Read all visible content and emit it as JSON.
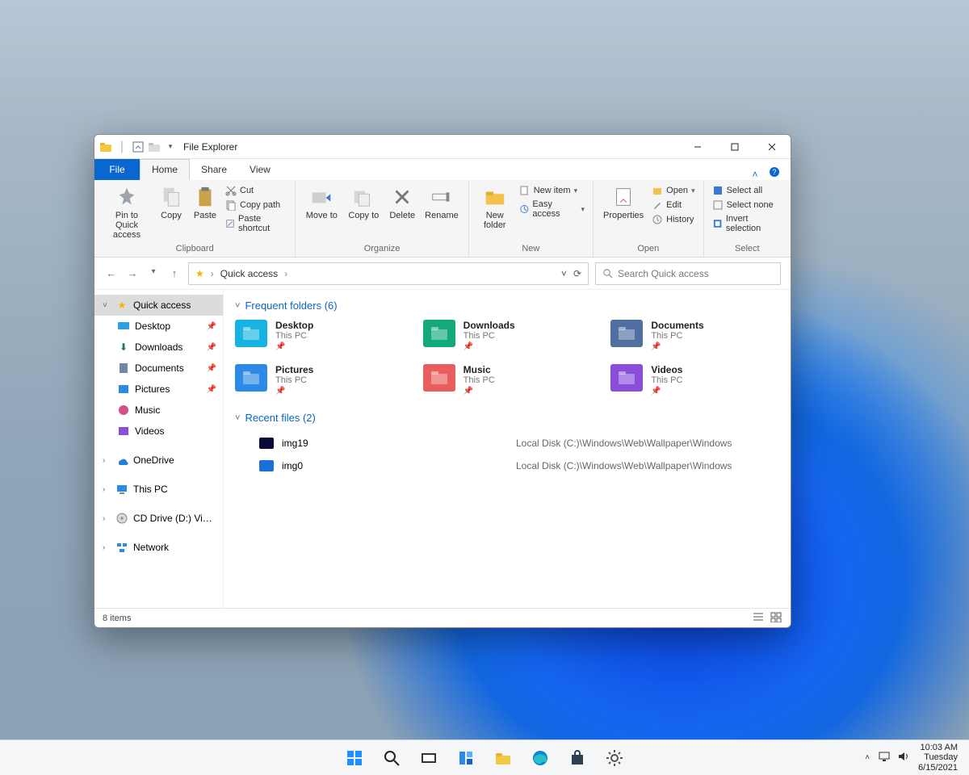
{
  "window": {
    "title": "File Explorer"
  },
  "tabs": {
    "file": "File",
    "home": "Home",
    "share": "Share",
    "view": "View"
  },
  "ribbon": {
    "clipboard": {
      "label": "Clipboard",
      "pin": "Pin to Quick access",
      "copy": "Copy",
      "paste": "Paste",
      "cut": "Cut",
      "copy_path": "Copy path",
      "paste_shortcut": "Paste shortcut"
    },
    "organize": {
      "label": "Organize",
      "move_to": "Move to",
      "copy_to": "Copy to",
      "delete": "Delete",
      "rename": "Rename"
    },
    "new": {
      "label": "New",
      "new_folder": "New folder",
      "new_item": "New item",
      "easy_access": "Easy access"
    },
    "open": {
      "label": "Open",
      "properties": "Properties",
      "open": "Open",
      "edit": "Edit",
      "history": "History"
    },
    "select": {
      "label": "Select",
      "all": "Select all",
      "none": "Select none",
      "invert": "Invert selection"
    }
  },
  "address": {
    "crumb": "Quick access"
  },
  "search": {
    "placeholder": "Search Quick access"
  },
  "nav": {
    "quick_access": "Quick access",
    "desktop": "Desktop",
    "downloads": "Downloads",
    "documents": "Documents",
    "pictures": "Pictures",
    "music": "Music",
    "videos": "Videos",
    "onedrive": "OneDrive",
    "this_pc": "This PC",
    "cd_drive": "CD Drive (D:) VirtualB",
    "network": "Network"
  },
  "sections": {
    "frequent": "Frequent folders (6)",
    "recent": "Recent files (2)"
  },
  "folders": [
    {
      "name": "Desktop",
      "location": "This PC",
      "color": "#16b4e2"
    },
    {
      "name": "Downloads",
      "location": "This PC",
      "color": "#13a97a"
    },
    {
      "name": "Documents",
      "location": "This PC",
      "color": "#4f6fa0"
    },
    {
      "name": "Pictures",
      "location": "This PC",
      "color": "#2b8be6"
    },
    {
      "name": "Music",
      "location": "This PC",
      "color": "#e85d5d"
    },
    {
      "name": "Videos",
      "location": "This PC",
      "color": "#8a4edb"
    }
  ],
  "recent": [
    {
      "name": "img19",
      "path": "Local Disk (C:)\\Windows\\Web\\Wallpaper\\Windows",
      "color": "#0b0b3a"
    },
    {
      "name": "img0",
      "path": "Local Disk (C:)\\Windows\\Web\\Wallpaper\\Windows",
      "color": "#1b6fd8"
    }
  ],
  "status": {
    "items": "8 items"
  },
  "taskbar": {
    "time": "10:03 AM",
    "day": "Tuesday",
    "date": "6/15/2021"
  }
}
